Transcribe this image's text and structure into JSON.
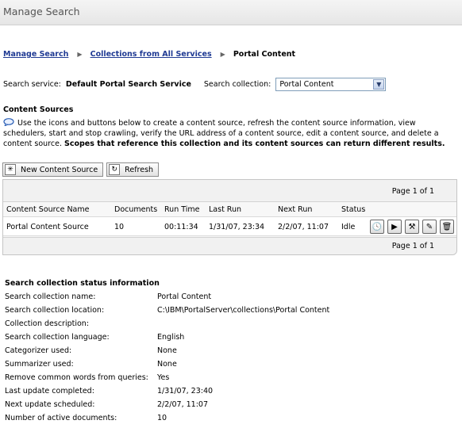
{
  "window": {
    "title": "Manage Search"
  },
  "breadcrumb": {
    "items": [
      {
        "label": "Manage Search"
      },
      {
        "label": "Collections from All Services"
      }
    ],
    "current": "Portal Content"
  },
  "service": {
    "service_label": "Search service:",
    "service_value": "Default Portal Search Service",
    "collection_label": "Search collection:",
    "collection_selected": "Portal Content"
  },
  "content_sources": {
    "title": "Content Sources",
    "help_text": "Use the icons and buttons below to create a content source, refresh the content source information, view schedulers, start and stop crawling, verify the URL address of a content source, edit a content source, and delete a content source.",
    "help_bold": "Scopes that reference this collection and its content sources can return different results."
  },
  "toolbar": {
    "new_label": "New Content Source",
    "refresh_label": "Refresh"
  },
  "table": {
    "pager_top": "Page 1 of 1",
    "pager_bottom": "Page 1 of 1",
    "columns": [
      "Content Source Name",
      "Documents",
      "Run Time",
      "Last Run",
      "Next Run",
      "Status"
    ],
    "rows": [
      [
        "Portal Content Source",
        "10",
        "00:11:34",
        "1/31/07, 23:34",
        "2/2/07, 11:07",
        "Idle"
      ]
    ],
    "row_actions": [
      "clock-icon",
      "play-icon",
      "wrench-icon",
      "edit-icon",
      "trash-icon"
    ]
  },
  "status_info": {
    "title": "Search collection status information",
    "rows": [
      {
        "k": "Search collection name:",
        "v": "Portal Content"
      },
      {
        "k": "Search collection location:",
        "v": "C:\\IBM\\PortalServer\\collections\\Portal Content"
      },
      {
        "k": "Collection description:",
        "v": ""
      },
      {
        "k": "Search collection language:",
        "v": "English"
      },
      {
        "k": "Categorizer used:",
        "v": "None"
      },
      {
        "k": "Summarizer used:",
        "v": "None"
      },
      {
        "k": "Remove common words from queries:",
        "v": "Yes"
      },
      {
        "k": "Last update completed:",
        "v": "1/31/07, 23:40"
      },
      {
        "k": "Next update scheduled:",
        "v": "2/2/07, 11:07"
      },
      {
        "k": "Number of active documents:",
        "v": "10"
      }
    ]
  }
}
